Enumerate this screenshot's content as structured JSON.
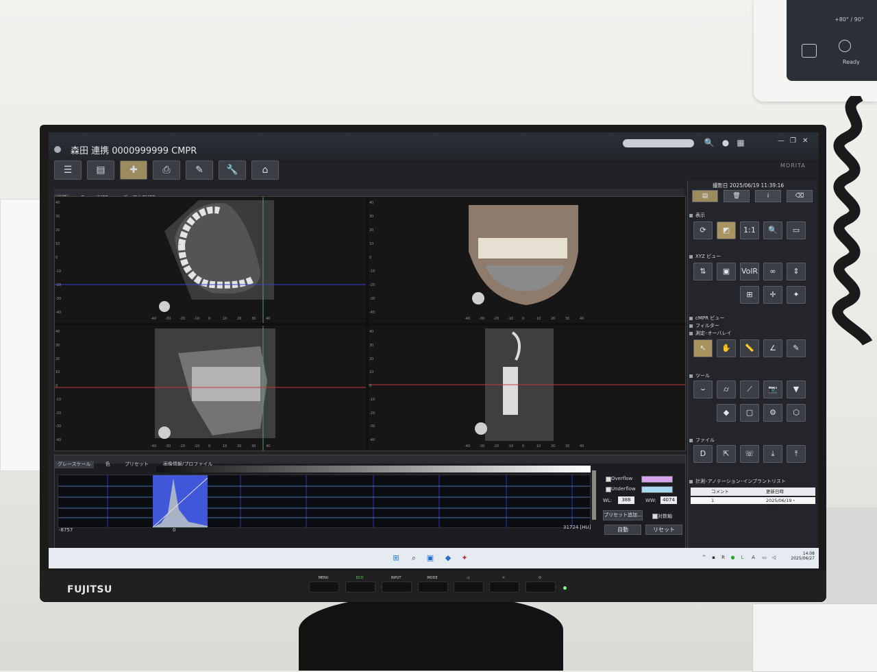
{
  "window": {
    "title": "森田 連携 0000999999  CMPR",
    "brand": "MORITA"
  },
  "toolbar": {
    "buttons": [
      {
        "icon": "list-icon",
        "glyph": "☰"
      },
      {
        "icon": "layers-icon",
        "glyph": "▤"
      },
      {
        "icon": "cmpr-icon",
        "glyph": "✚"
      },
      {
        "icon": "print-icon",
        "glyph": "⎙"
      },
      {
        "icon": "report-icon",
        "glyph": "✎"
      },
      {
        "icon": "wrench-icon",
        "glyph": "🔧"
      },
      {
        "icon": "home-icon",
        "glyph": "⌂"
      }
    ]
  },
  "view_tabs": [
    "XYZ",
    "CurvedMPR",
    "デュアルCMPR"
  ],
  "rulers": {
    "left_ticks": [
      "40",
      "30",
      "20",
      "10",
      "0",
      "-10",
      "-20",
      "-30",
      "-40"
    ],
    "bottom_ticks": [
      "-40",
      "-30",
      "-20",
      "-10",
      "0",
      "10",
      "20",
      "30",
      "40"
    ]
  },
  "histogram": {
    "tabs": [
      "グレースケール",
      "色",
      "プリセット",
      "画像情報/プロファイル"
    ],
    "min_label": "-8757",
    "zero_label": "0",
    "max_label": "31724 [HU]",
    "overflow_label": "Overflow",
    "underflow_label": "Underflow",
    "overflow_color": "#d9a4f2",
    "underflow_color": "#a7d9f2",
    "wl_label": "WL:",
    "wl_value": "388",
    "ww_label": "WW:",
    "ww_value": "4074",
    "preset_add": "プリセット追加...",
    "symmetric_axis": "対数軸",
    "auto_button": "自動",
    "reset_button": "リセット"
  },
  "right_panel": {
    "date": "撮影日 2025/06/19 11:39:16",
    "tabs": [
      {
        "icon": "layers-icon",
        "glyph": "▤"
      },
      {
        "icon": "trash-icon",
        "glyph": "🗑"
      },
      {
        "icon": "info-icon",
        "glyph": "i"
      },
      {
        "icon": "eraser-icon",
        "glyph": "⌫"
      }
    ],
    "sections": {
      "display": "表示",
      "xyz_view": "XYZ ビュー",
      "cmpr_view": "cMPR ビュー",
      "filter": "フィルター",
      "measure_overlay": "測定･オーバレイ",
      "tools": "ツール",
      "file": "ファイル",
      "annotation_list": "計測･アノテーション･インプラントリスト"
    },
    "display_buttons": [
      {
        "icon": "rotate-icon",
        "glyph": "⟳"
      },
      {
        "icon": "contrast-icon",
        "glyph": "◩"
      },
      {
        "icon": "scale-1-1-icon",
        "glyph": "1:1"
      },
      {
        "icon": "zoom-icon",
        "glyph": "🔍"
      },
      {
        "icon": "layout-icon",
        "glyph": "▭"
      }
    ],
    "xyz_buttons": [
      {
        "icon": "flip-icon",
        "glyph": "⇅"
      },
      {
        "icon": "image-icon",
        "glyph": "▣"
      },
      {
        "icon": "volr-icon",
        "glyph": "VolR"
      },
      {
        "icon": "link-icon",
        "glyph": "∞"
      },
      {
        "icon": "slice-icon",
        "glyph": "⇕"
      },
      {
        "icon": "grid-icon",
        "glyph": "⊞"
      },
      {
        "icon": "crosshair-icon",
        "glyph": "✛"
      },
      {
        "icon": "paint-icon",
        "glyph": "✦"
      }
    ],
    "measure_buttons": [
      {
        "icon": "pointer-icon",
        "glyph": "↖"
      },
      {
        "icon": "hand-icon",
        "glyph": "✋"
      },
      {
        "icon": "ruler-icon",
        "glyph": "📏"
      },
      {
        "icon": "angle-icon",
        "glyph": "∠"
      },
      {
        "icon": "pen-icon",
        "glyph": "✎"
      }
    ],
    "tool_buttons": [
      {
        "icon": "arch-icon",
        "glyph": "⌣"
      },
      {
        "icon": "cylinder-icon",
        "glyph": "⌭"
      },
      {
        "icon": "nerve-icon",
        "glyph": "⟋"
      },
      {
        "icon": "camera-icon",
        "glyph": "📷"
      },
      {
        "icon": "implant-icon",
        "glyph": "▼"
      },
      {
        "icon": "cube-icon",
        "glyph": "◆"
      },
      {
        "icon": "box-icon",
        "glyph": "▢"
      },
      {
        "icon": "gear-icon",
        "glyph": "⚙"
      },
      {
        "icon": "shield-icon",
        "glyph": "⬡"
      }
    ],
    "file_buttons": [
      {
        "icon": "dicom-icon",
        "glyph": "D"
      },
      {
        "icon": "export-icon",
        "glyph": "⇱"
      },
      {
        "icon": "phone-icon",
        "glyph": "☏"
      },
      {
        "icon": "download-icon",
        "glyph": "⤓"
      },
      {
        "icon": "save-icon",
        "glyph": "⤒"
      }
    ],
    "list": {
      "col_comment": "コメント",
      "col_updated": "更新日時",
      "row_value": "1",
      "row_date": "2025/06/19・ 11:41:..."
    }
  },
  "taskbar": {
    "time": "14:08",
    "date": "2025/06/27"
  },
  "monitor": {
    "brand": "FUJITSU",
    "buttons": [
      "MENU",
      "ECO",
      "INPUT",
      "MODE",
      "◁",
      "☼",
      "⏻"
    ]
  },
  "controller": {
    "status": "Ready",
    "angle": "+80° / 90°"
  }
}
